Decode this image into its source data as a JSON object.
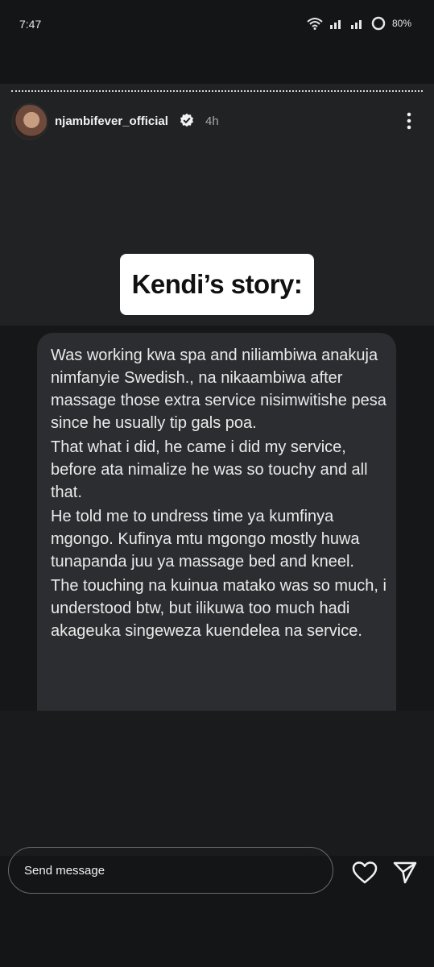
{
  "status_bar": {
    "time": "7:47",
    "battery": "80%",
    "icons": [
      "wifi-icon",
      "signal-icon",
      "signal-icon",
      "battery-icon"
    ]
  },
  "story": {
    "username": "njambifever_official",
    "age": "4h",
    "title": "Kendi’s story:",
    "paragraphs": [
      "Was working kwa spa and niliambiwa anakuja nimfanyie Swedish., na nikaambiwa after massage those extra service nisimwitishe pesa since he usually tip gals poa.",
      "That what i did, he came i did my service, before ata nimalize he was so touchy and all that.",
      "He told me to undress time ya kumfinya mgongo. Kufinya mtu mgongo mostly huwa tunapanda juu ya massage bed and kneel.",
      "The touching na kuinua matako was so much, i understood btw, but ilikuwa too much hadi akageuka singeweza kuendelea na service."
    ]
  },
  "reply": {
    "placeholder": "Send message"
  }
}
